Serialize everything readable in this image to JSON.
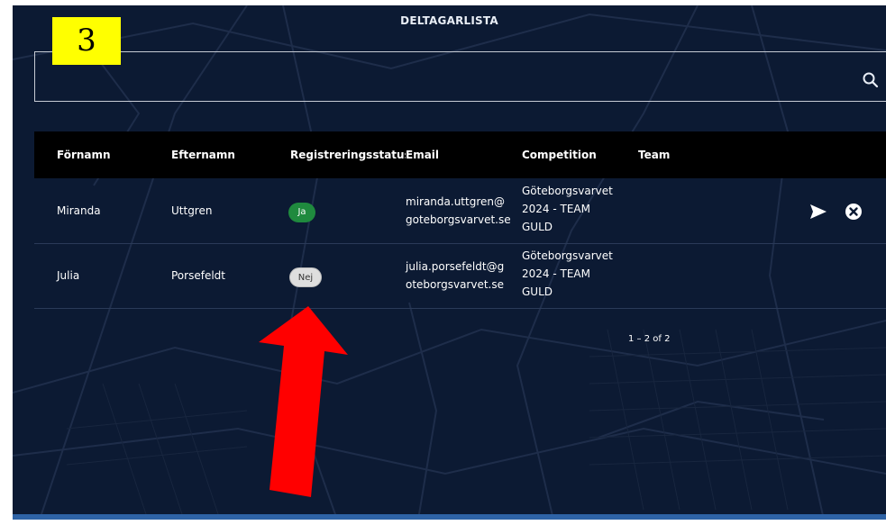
{
  "page": {
    "title": "DELTAGARLISTA",
    "annotation_number": "3"
  },
  "search": {
    "placeholder": ""
  },
  "table": {
    "headers": [
      "Förnamn",
      "Efternamn",
      "Registreringsstatus",
      "Email",
      "Competition",
      "Team"
    ],
    "rows": [
      {
        "first_name": "Miranda",
        "last_name": "Uttgren",
        "status": "Ja",
        "email_line1": "miranda.uttgren@",
        "email_line2": "goteborgsvarvet.se",
        "competition_line1": "Göteborgsvarvet",
        "competition_line2": "2024 - TEAM",
        "competition_line3": "GULD",
        "team": ""
      },
      {
        "first_name": "Julia",
        "last_name": "Porsefeldt",
        "status": "Nej",
        "email_line1": "julia.porsefeldt@g",
        "email_line2": "oteborgsvarvet.se",
        "competition_line1": "Göteborgsvarvet",
        "competition_line2": "2024 - TEAM",
        "competition_line3": "GULD",
        "team": ""
      }
    ]
  },
  "pagination": {
    "range": "1 – 2 of 2"
  },
  "icons": {
    "send": "send-icon",
    "cancel": "cancel-icon",
    "search": "search-icon"
  },
  "colors": {
    "background": "#0c1a33",
    "header": "#000000",
    "status_yes": "#1f8a3e",
    "status_no": "#dedede",
    "annotation_badge": "#ffff00",
    "annotation_arrow": "#ff0000"
  }
}
